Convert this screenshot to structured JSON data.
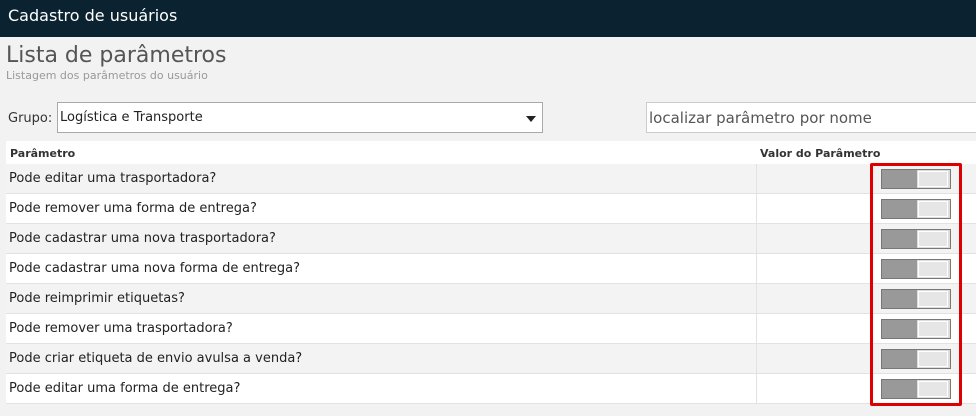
{
  "window": {
    "title": "Cadastro de usuários"
  },
  "header": {
    "title": "Lista de parâmetros",
    "subtitle": "Listagem dos parâmetros do usuário"
  },
  "filters": {
    "group_label": "Grupo:",
    "group_value": "Logística e Transporte",
    "search_placeholder": "localizar parâmetro por nome"
  },
  "table": {
    "columns": [
      "Parâmetro",
      "Valor do Parâmetro"
    ],
    "rows": [
      {
        "name": "Pode editar uma trasportadora?",
        "value": "off"
      },
      {
        "name": "Pode remover uma forma de entrega?",
        "value": "off"
      },
      {
        "name": "Pode cadastrar uma nova trasportadora?",
        "value": "off"
      },
      {
        "name": "Pode cadastrar uma nova forma de entrega?",
        "value": "off"
      },
      {
        "name": "Pode reimprimir etiquetas?",
        "value": "off"
      },
      {
        "name": "Pode remover uma trasportadora?",
        "value": "off"
      },
      {
        "name": "Pode criar etiqueta de envio avulsa a venda?",
        "value": "off"
      },
      {
        "name": "Pode editar uma forma de entrega?",
        "value": "off"
      }
    ]
  },
  "colors": {
    "titlebar": "#0b2330",
    "highlight": "#dd0000",
    "toggle_off": "#999999"
  }
}
